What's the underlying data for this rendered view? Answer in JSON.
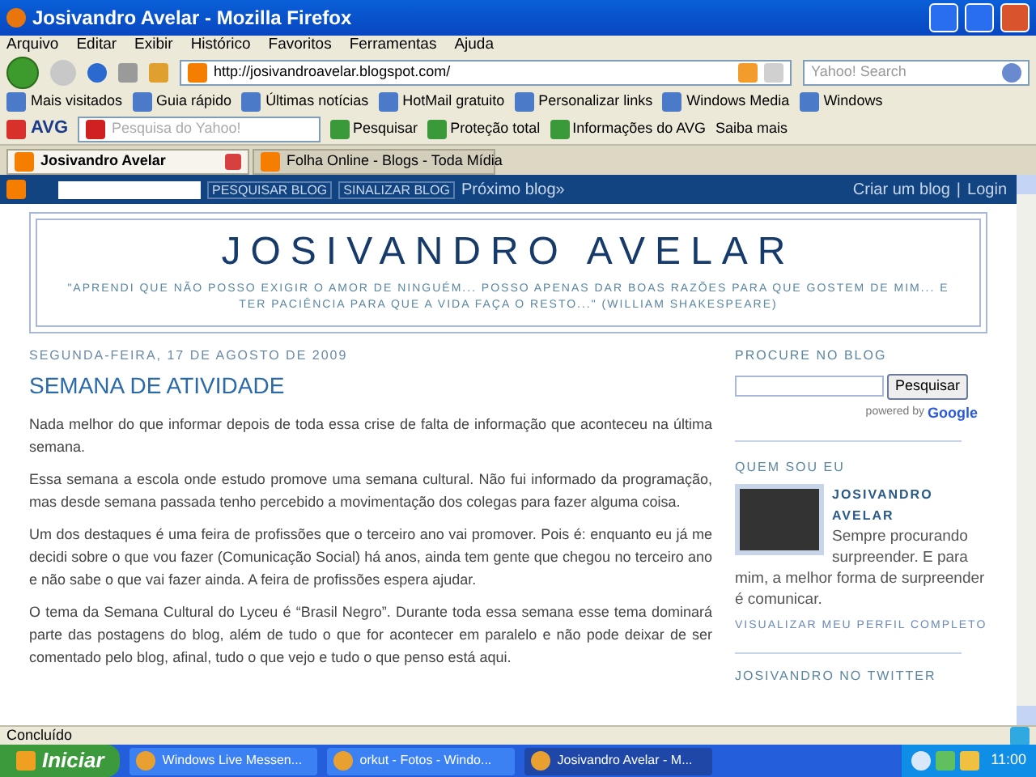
{
  "window": {
    "title": "Josivandro Avelar - Mozilla Firefox"
  },
  "menu": [
    "Arquivo",
    "Editar",
    "Exibir",
    "Histórico",
    "Favoritos",
    "Ferramentas",
    "Ajuda"
  ],
  "nav": {
    "url": "http://josivandroavelar.blogspot.com/",
    "search_placeholder": "Yahoo! Search"
  },
  "bookmarks": [
    "Mais visitados",
    "Guia rápido",
    "Últimas notícias",
    "HotMail gratuito",
    "Personalizar links",
    "Windows Media",
    "Windows"
  ],
  "avg_toolbar": {
    "brand": "AVG",
    "search_placeholder": "Pesquisa do Yahoo!",
    "items": [
      "Pesquisar",
      "Proteção total",
      "Informações do AVG",
      "Saiba mais"
    ]
  },
  "tabs": [
    {
      "label": "Josivandro Avelar",
      "selected": true
    },
    {
      "label": "Folha Online - Blogs - Toda Mídia",
      "selected": false
    }
  ],
  "blogger_bar": {
    "buttons": [
      "PESQUISAR BLOG",
      "SINALIZAR BLOG"
    ],
    "next": "Próximo blog»",
    "links": [
      "Criar um blog",
      "Login"
    ],
    "separator": "|"
  },
  "header": {
    "title": "JOSIVANDRO AVELAR",
    "description": "\"APRENDI QUE NÃO POSSO EXIGIR O AMOR DE NINGUÉM... POSSO APENAS DAR BOAS RAZÕES PARA QUE GOSTEM DE MIM... E TER PACIÊNCIA PARA QUE A VIDA FAÇA O RESTO...\" (WILLIAM SHAKESPEARE)"
  },
  "post": {
    "date": "SEGUNDA-FEIRA, 17 DE AGOSTO DE 2009",
    "title": "SEMANA DE ATIVIDADE",
    "paragraphs": [
      "Nada melhor do que informar depois de toda essa crise de falta de informação que aconteceu na última semana.",
      "Essa semana a escola onde estudo promove uma semana cultural. Não fui informado da programação, mas desde semana passada tenho percebido a movimentação dos colegas para fazer alguma coisa.",
      "Um dos destaques é uma feira de profissões que o terceiro ano vai promover. Pois é: enquanto eu já me decidi sobre o que vou fazer (Comunicação Social) há anos, ainda tem gente que chegou no terceiro ano e não sabe o que vai fazer ainda. A feira de profissões espera ajudar.",
      "O tema da Semana Cultural do Lyceu é “Brasil Negro”. Durante toda essa semana esse tema dominará parte das postagens do blog, além de tudo o que for acontecer em paralelo e não pode deixar de ser comentado pelo blog, afinal, tudo o que vejo e tudo o que penso está aqui."
    ]
  },
  "sidebar": {
    "search": {
      "heading": "PROCURE NO BLOG",
      "button": "Pesquisar",
      "powered": "powered by",
      "google": "Google"
    },
    "profile": {
      "heading": "QUEM SOU EU",
      "name": "JOSIVANDRO AVELAR",
      "bio": "Sempre procurando surpreender. E para mim, a melhor forma de surpreender é comunicar.",
      "link": "VISUALIZAR MEU PERFIL COMPLETO"
    },
    "next_heading": "JOSIVANDRO NO TWITTER"
  },
  "status_bar": "Concluído",
  "taskbar": {
    "start": "Iniciar",
    "items": [
      {
        "label": "Windows Live Messen...",
        "selected": false
      },
      {
        "label": "orkut - Fotos - Windo...",
        "selected": false
      },
      {
        "label": "Josivandro Avelar - M...",
        "selected": true
      }
    ],
    "clock": "11:00"
  }
}
